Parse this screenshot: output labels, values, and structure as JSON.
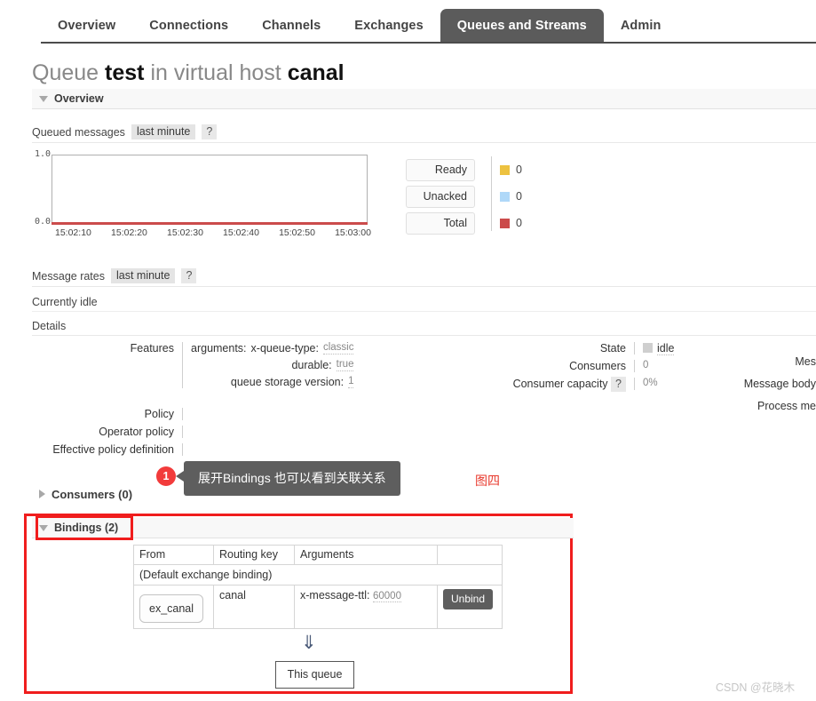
{
  "nav": {
    "tabs": [
      {
        "label": "Overview",
        "active": false
      },
      {
        "label": "Connections",
        "active": false
      },
      {
        "label": "Channels",
        "active": false
      },
      {
        "label": "Exchanges",
        "active": false
      },
      {
        "label": "Queues and Streams",
        "active": true
      },
      {
        "label": "Admin",
        "active": false
      }
    ]
  },
  "title": {
    "prefix": "Queue",
    "queue_name": "test",
    "middle": "in virtual host",
    "vhost": "canal"
  },
  "overview": {
    "header": "Overview",
    "queued_messages_label": "Queued messages",
    "queued_messages_period": "last minute",
    "help": "?",
    "message_rates_label": "Message rates",
    "message_rates_period": "last minute",
    "currently_idle": "Currently idle",
    "details_label": "Details"
  },
  "chart_data": {
    "type": "line",
    "title": "Queued messages",
    "xlabel": "",
    "ylabel": "",
    "ylim": [
      0.0,
      1.0
    ],
    "ytick_labels": [
      "1.0",
      "0.0"
    ],
    "x": [
      "15:02:10",
      "15:02:20",
      "15:02:30",
      "15:02:40",
      "15:02:50",
      "15:03:00"
    ],
    "grid": false,
    "legend_position": "right",
    "series": [
      {
        "name": "Ready",
        "color": "#edc240",
        "value": "0",
        "values": [
          0,
          0,
          0,
          0,
          0,
          0
        ]
      },
      {
        "name": "Unacked",
        "color": "#afd8f8",
        "value": "0",
        "values": [
          0,
          0,
          0,
          0,
          0,
          0
        ]
      },
      {
        "name": "Total",
        "color": "#cb4b4b",
        "value": "0",
        "values": [
          0,
          0,
          0,
          0,
          0,
          0
        ]
      }
    ]
  },
  "details": {
    "features_label": "Features",
    "arguments_key": "arguments:",
    "arguments_name": "x-queue-type:",
    "arguments_value": "classic",
    "durable_key": "durable:",
    "durable_value": "true",
    "storage_key": "queue storage version:",
    "storage_value": "1",
    "policy_label": "Policy",
    "operator_policy_label": "Operator policy",
    "effective_policy_label": "Effective policy definition",
    "state_label": "State",
    "state_value": "idle",
    "consumers_label": "Consumers",
    "consumers_value": "0",
    "consumer_capacity_label": "Consumer capacity",
    "consumer_capacity_help": "?",
    "consumer_capacity_value": "0%",
    "right_cut_1": "Mes",
    "right_cut_2": "Message body",
    "right_cut_3": "Process me"
  },
  "annotation": {
    "badge": "1",
    "text": "展开Bindings 也可以看到关联关系",
    "figure_label": "图四"
  },
  "consumers_section": {
    "header": "Consumers (0)"
  },
  "bindings_section": {
    "header": "Bindings (2)",
    "columns": [
      "From",
      "Routing key",
      "Arguments",
      ""
    ],
    "default_row": "(Default exchange binding)",
    "rows": [
      {
        "from": "ex_canal",
        "routing_key": "canal",
        "arg_key": "x-message-ttl:",
        "arg_value": "60000",
        "action": "Unbind"
      }
    ],
    "arrow": "⇓",
    "this_queue": "This queue"
  },
  "watermark": "CSDN @花晓木",
  "colors": {
    "accent_tab": "#5b5b5b",
    "ready": "#edc240",
    "unacked": "#afd8f8",
    "total": "#cb4b4b",
    "highlight_red": "#f01d1d",
    "badge_red": "#f23b3b",
    "figure_red": "#e8392d"
  }
}
